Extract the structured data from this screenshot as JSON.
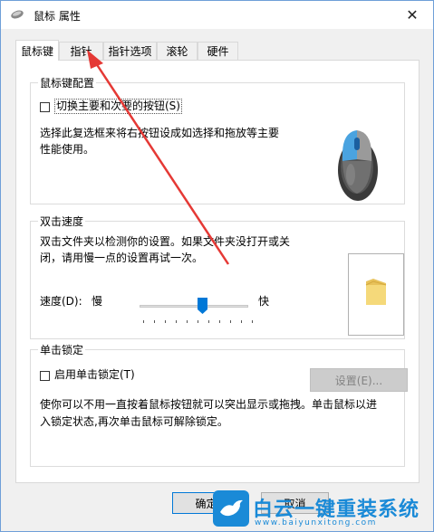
{
  "window": {
    "title": "鼠标 属性",
    "close_glyph": "✕"
  },
  "tabs": [
    {
      "label": "鼠标键"
    },
    {
      "label": "指针"
    },
    {
      "label": "指针选项"
    },
    {
      "label": "滚轮"
    },
    {
      "label": "硬件"
    }
  ],
  "button_config": {
    "group_label": "鼠标键配置",
    "switch_label": "切换主要和次要的按钮(S)",
    "switch_checked": false,
    "description": "选择此复选框来将右按钮设成如选择和拖放等主要性能使用。",
    "desc_line1": "选择此复选框来将右按钮设成如选择和拖放等主要",
    "desc_line2": "性能使用。"
  },
  "double_click": {
    "group_label": "双击速度",
    "desc_line1": "双击文件夹以检测你的设置。如果文件夹没打开或关",
    "desc_line2": "闭，请用慢一点的设置再试一次。",
    "speed_label": "速度(D):",
    "slow": "慢",
    "fast": "快",
    "slider_value": 0.6
  },
  "click_lock": {
    "group_label": "单击锁定",
    "enable_label": "启用单击锁定(T)",
    "enable_checked": false,
    "settings_label": "设置(E)...",
    "desc_line1": "使你可以不用一直按着鼠标按钮就可以突出显示或拖拽。单击鼠标以进",
    "desc_line2": "入锁定状态,再次单击鼠标可解除锁定。"
  },
  "buttons": {
    "ok": "确定",
    "cancel": "取消"
  },
  "watermark": {
    "title": "白云一键重装系统",
    "url": "www.baiyunxitong.com"
  },
  "icons": [
    "mouse-icon",
    "folder-icon",
    "close-icon",
    "slider-thumb-icon",
    "bird-logo-icon"
  ],
  "colors": {
    "accent": "#0078d7",
    "annotation_arrow": "#e53935",
    "watermark": "#1a8ad7"
  }
}
